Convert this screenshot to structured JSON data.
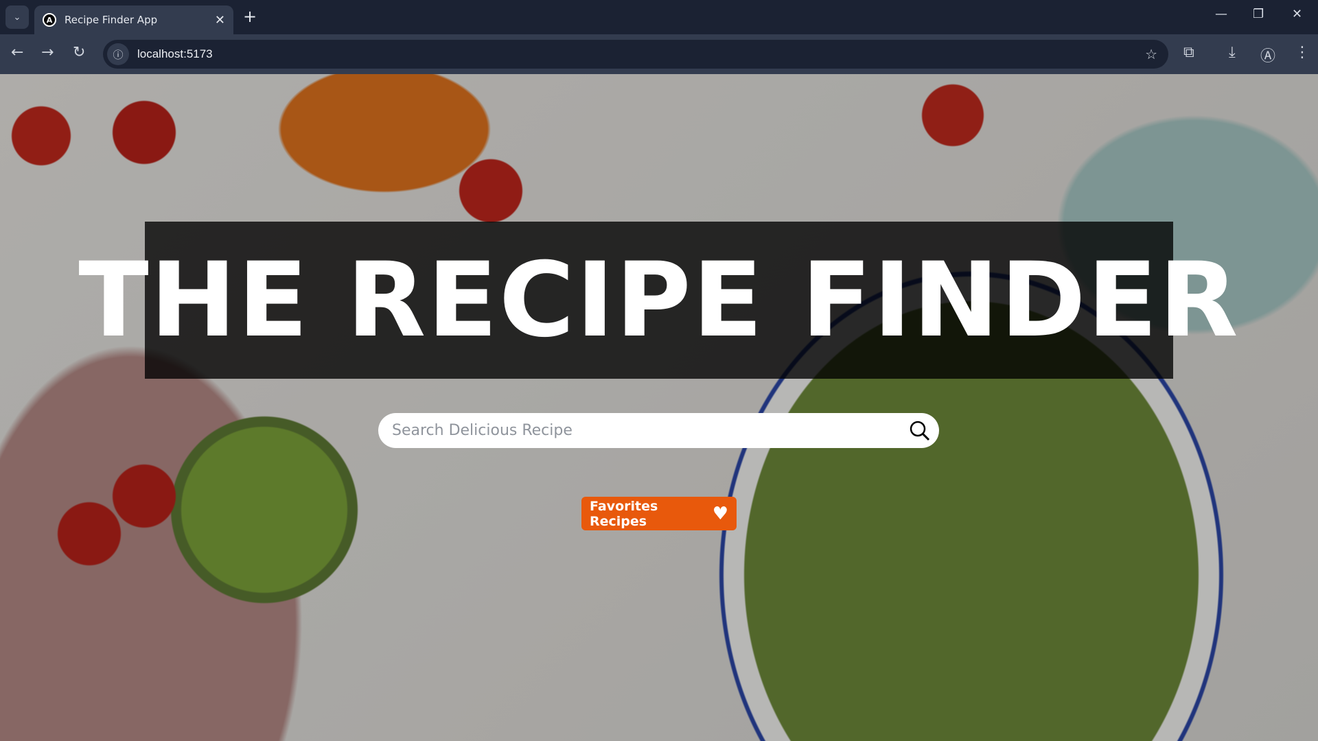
{
  "browser": {
    "tab_title": "Recipe Finder App",
    "url": "localhost:5173"
  },
  "app": {
    "title": "THE RECIPE FINDER",
    "search_placeholder": "Search Delicious Recipe",
    "favorites_label": "Favorites Recipes",
    "accent_color": "#e8590c"
  }
}
